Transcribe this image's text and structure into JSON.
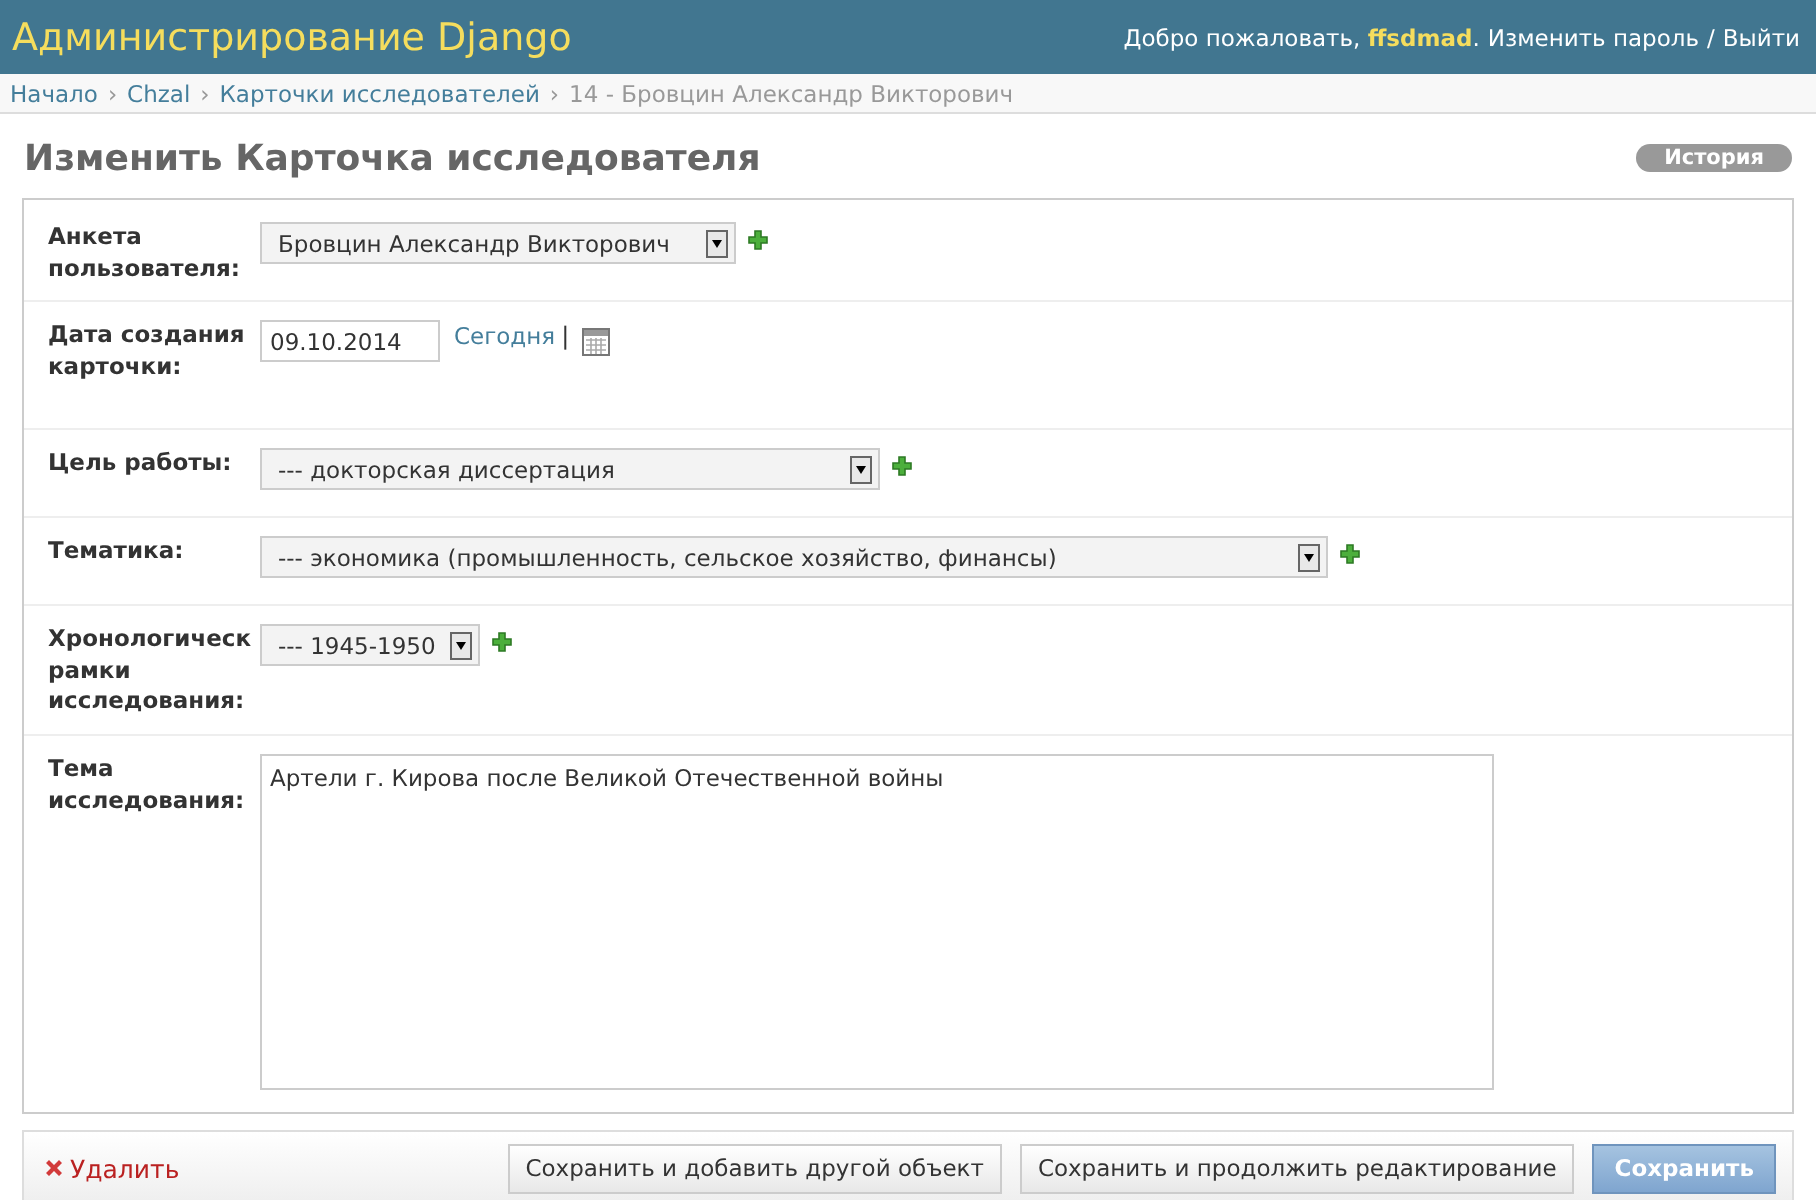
{
  "header": {
    "title": "Администрирование Django",
    "welcome": "Добро пожаловать, **ffsdmad**.",
    "links": [
      "Изменить пароль",
      "Выйти"
    ],
    "link_separator": "/"
  },
  "breadcrumbs": {
    "separator": "›",
    "items": [
      {
        "label": "Начало",
        "current": false
      },
      {
        "label": "Chzal",
        "current": false
      },
      {
        "label": "Карточки исследователей",
        "current": false
      },
      {
        "label": "14 - Бровцин Александр Викторович",
        "current": true
      }
    ]
  },
  "page_title": "Изменить Карточка исследователя",
  "history_button": "История",
  "fields": [
    {
      "kind": "select",
      "label": "Анкета пользователя:",
      "value": "Бровцин Александр Викторович",
      "add": true
    },
    {
      "kind": "date",
      "label": "Дата создания карточки:",
      "value": "09.10.2014",
      "today": "Сегодня",
      "separator": "|"
    },
    {
      "kind": "select",
      "label": "Цель работы:",
      "value": "--- докторская диссертация",
      "add": true
    },
    {
      "kind": "select",
      "label": "Тематика:",
      "value": "--- экономика (промышленность, сельское хозяйство, финансы)",
      "add": true
    },
    {
      "kind": "select",
      "label": "Хронологическ рамки исследования:",
      "value": "--- 1945-1950",
      "add": true
    },
    {
      "kind": "textarea",
      "label": "Тема исследования:",
      "value": "Артели г. Кирова после Великой Отечественной войны"
    }
  ],
  "delete_link": "Удалить",
  "buttons": [
    {
      "kind": "secondary",
      "label": "Сохранить и добавить другой объект"
    },
    {
      "kind": "secondary",
      "label": "Сохранить и продолжить редактирование"
    },
    {
      "kind": "primary",
      "label": "Сохранить"
    }
  ]
}
